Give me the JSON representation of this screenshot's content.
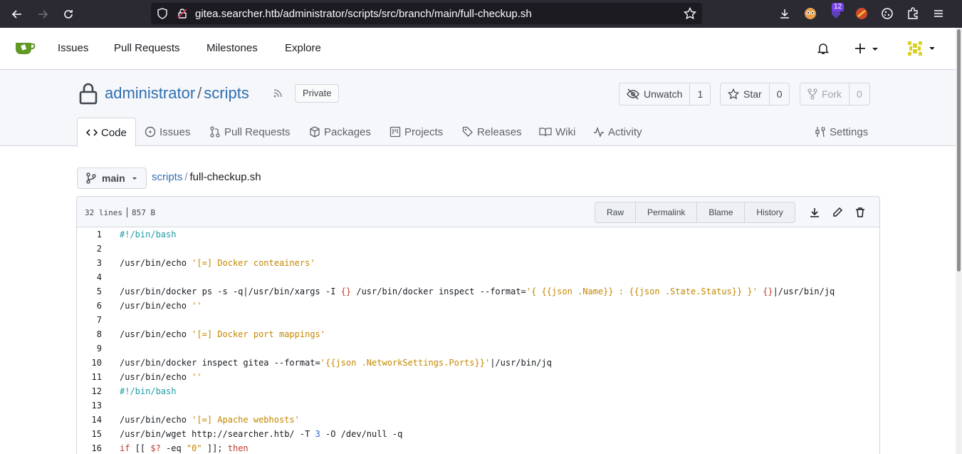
{
  "browser": {
    "url": "gitea.searcher.htb/administrator/scripts/src/branch/main/full-checkup.sh",
    "extension_badge": "12"
  },
  "nav": {
    "items": [
      "Issues",
      "Pull Requests",
      "Milestones",
      "Explore"
    ]
  },
  "repo": {
    "owner": "administrator",
    "separator": "/",
    "name": "scripts",
    "visibility": "Private",
    "unwatch_label": "Unwatch",
    "watch_count": "1",
    "star_label": "Star",
    "star_count": "0",
    "fork_label": "Fork",
    "fork_count": "0"
  },
  "tabs": [
    "Code",
    "Issues",
    "Pull Requests",
    "Packages",
    "Projects",
    "Releases",
    "Wiki",
    "Activity",
    "Settings"
  ],
  "branch": "main",
  "breadcrumb": {
    "folder": "scripts",
    "separator": "/",
    "file": "full-checkup.sh"
  },
  "file": {
    "lines": "32 lines",
    "size": "857 B",
    "actions": [
      "Raw",
      "Permalink",
      "Blame",
      "History"
    ]
  },
  "code_lines": [
    {
      "n": "1",
      "segs": [
        [
          "c",
          "#!/bin/bash"
        ]
      ]
    },
    {
      "n": "2",
      "segs": []
    },
    {
      "n": "3",
      "segs": [
        [
          "t",
          "/usr/bin/echo "
        ],
        [
          "s",
          "'[=] Docker conteainers'"
        ]
      ]
    },
    {
      "n": "4",
      "segs": []
    },
    {
      "n": "5",
      "segs": [
        [
          "t",
          "/usr/bin/docker ps -s -q|/usr/bin/xargs -I "
        ],
        [
          "v",
          "{}"
        ],
        [
          "t",
          " /usr/bin/docker inspect --format="
        ],
        [
          "s",
          "'{ {{json .Name}} : {{json .State.Status}} }'"
        ],
        [
          "t",
          " "
        ],
        [
          "v",
          "{}"
        ],
        [
          "t",
          "|/usr/bin/jq"
        ]
      ]
    },
    {
      "n": "6",
      "segs": [
        [
          "t",
          "/usr/bin/echo "
        ],
        [
          "s",
          "''"
        ]
      ]
    },
    {
      "n": "7",
      "segs": []
    },
    {
      "n": "8",
      "segs": [
        [
          "t",
          "/usr/bin/echo "
        ],
        [
          "s",
          "'[=] Docker port mappings'"
        ]
      ]
    },
    {
      "n": "9",
      "segs": []
    },
    {
      "n": "10",
      "segs": [
        [
          "t",
          "/usr/bin/docker inspect gitea --format="
        ],
        [
          "s",
          "'{{json .NetworkSettings.Ports}}'"
        ],
        [
          "t",
          "|/usr/bin/jq"
        ]
      ]
    },
    {
      "n": "11",
      "segs": [
        [
          "t",
          "/usr/bin/echo "
        ],
        [
          "s",
          "''"
        ]
      ]
    },
    {
      "n": "12",
      "segs": [
        [
          "c",
          "#!/bin/bash"
        ]
      ]
    },
    {
      "n": "13",
      "segs": []
    },
    {
      "n": "14",
      "segs": [
        [
          "t",
          "/usr/bin/echo "
        ],
        [
          "s",
          "'[=] Apache webhosts'"
        ]
      ]
    },
    {
      "n": "15",
      "segs": [
        [
          "t",
          "/usr/bin/wget http://searcher.htb/ -T "
        ],
        [
          "n",
          "3"
        ],
        [
          "t",
          " -O /dev/null -q"
        ]
      ]
    },
    {
      "n": "16",
      "segs": [
        [
          "k",
          "if"
        ],
        [
          "t",
          " [[ "
        ],
        [
          "v",
          "$?"
        ],
        [
          "t",
          " -eq "
        ],
        [
          "s",
          "\"0\""
        ],
        [
          "t",
          " ]]; "
        ],
        [
          "k",
          "then"
        ]
      ]
    }
  ]
}
